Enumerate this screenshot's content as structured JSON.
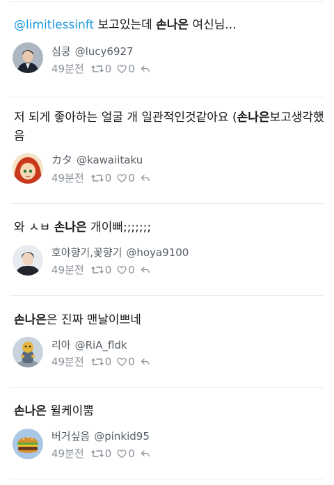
{
  "tweets": [
    {
      "text_parts": [
        {
          "text": "@limitlessinft",
          "style": "mention"
        },
        {
          "text": " 보고있는데 ",
          "style": "normal"
        },
        {
          "text": "손나은",
          "style": "highlight"
        },
        {
          "text": " 여신님...",
          "style": "normal"
        }
      ],
      "display_name": "심쿵",
      "handle": "@lucy6927",
      "time": "49분전",
      "retweets": "0",
      "likes": "0",
      "avatar": "avatar-boy-in-suit"
    },
    {
      "text_parts": [
        {
          "text": "저 되게 좋아하는 얼굴 개 일관적인것같아요 (",
          "style": "normal"
        },
        {
          "text": "손나은",
          "style": "highlight"
        },
        {
          "text": "보고생각했음",
          "style": "normal"
        }
      ],
      "display_name": "カタ",
      "handle": "@kawaiitaku",
      "time": "49분전",
      "retweets": "0",
      "likes": "0",
      "avatar": "avatar-anime-redhead"
    },
    {
      "text_parts": [
        {
          "text": "와 ㅅㅂ ",
          "style": "normal"
        },
        {
          "text": "손나은",
          "style": "highlight"
        },
        {
          "text": " 개이뻐;;;;;;;",
          "style": "normal"
        }
      ],
      "display_name": "호야향기,꽃향기",
      "handle": "@hoya9100",
      "time": "49분전",
      "retweets": "0",
      "likes": "0",
      "avatar": "avatar-young-man"
    },
    {
      "text_parts": [
        {
          "text": "손나은",
          "style": "highlight"
        },
        {
          "text": "은 진짜 맨날이쁘네",
          "style": "normal"
        }
      ],
      "display_name": "리아",
      "handle": "@RiA_fldk",
      "time": "49분전",
      "retweets": "0",
      "likes": "0",
      "avatar": "avatar-cartoon-figure"
    },
    {
      "text_parts": [
        {
          "text": "손나은",
          "style": "highlight"
        },
        {
          "text": " 윌케이뿜",
          "style": "normal"
        }
      ],
      "display_name": "버거싶음",
      "handle": "@pinkid95",
      "time": "49분전",
      "retweets": "0",
      "likes": "0",
      "avatar": "avatar-burger"
    }
  ],
  "icons": {
    "retweet": "retweet-icon",
    "like": "heart-icon",
    "reply": "reply-icon"
  },
  "colors": {
    "mention": "#1b95e0",
    "text": "#14171a",
    "meta": "#8a9199",
    "divider": "#e6ecf0"
  }
}
